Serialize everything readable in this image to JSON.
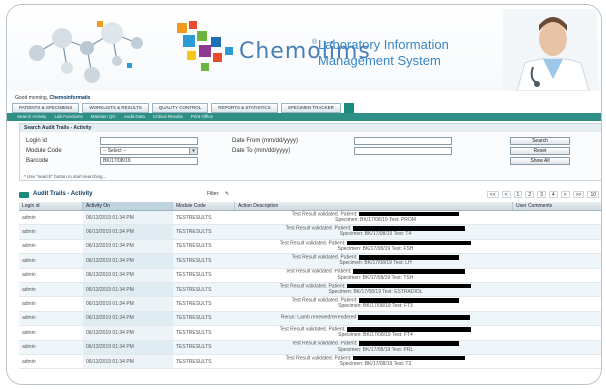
{
  "app": {
    "logo_text": "Chemolims",
    "logo_registered": "®",
    "tagline_line1": "Laboratory Information",
    "tagline_line2": "Management System"
  },
  "nav": {
    "welcome_prefix": "Good morning,",
    "welcome_user": "Chemoinformatix",
    "tabs": [
      "PATIENTS & SPECIMENS",
      "WORKLISTS & RESULTS",
      "QUALITY CONTROL",
      "REPORTS & STATISTICS",
      "SPECIMEN TRACKER"
    ],
    "sub_items": [
      "Search Activity",
      "Lab Functions",
      "Maintain QC",
      "Audit Data",
      "Critical Results",
      "Print Office"
    ]
  },
  "search": {
    "title": "Search Audit Trails - Activity",
    "login_id_label": "Login id",
    "login_id_value": "",
    "module_code_label": "Module Code",
    "module_code_value": "-- Select --",
    "barcode_label": "Barcode",
    "barcode_value": "BK/17/08/19",
    "date_from_label": "Date From (mm/dd/yyyy)",
    "date_from_value": "",
    "date_to_label": "Date To (mm/dd/yyyy)",
    "date_to_value": "",
    "search_button": "Search",
    "reset_button": "Reset",
    "show_all_button": "Show All",
    "hint": "* Use \"search\" button to start searching..."
  },
  "grid": {
    "title": "Audit Trails - Activity",
    "filter_label": "Filter:",
    "pager": [
      "<<",
      "<",
      "1",
      "2",
      "3",
      "4",
      ">",
      ">>",
      "10"
    ],
    "columns": [
      "Login id",
      "Activity On",
      "Module Code",
      "Action Description",
      "User Comments"
    ],
    "rows": [
      {
        "login": "admin",
        "on": "06/13/2019 01:34 PM",
        "module": "TESTRESULTS",
        "desc1": "Test Result validated. Patient:",
        "desc2": "Specimen: BK/17/08/19 Test: PROM"
      },
      {
        "login": "admin",
        "on": "06/13/2019 01:34 PM",
        "module": "TESTRESULTS",
        "desc1": "Test Result validated. Patient:",
        "desc2": "Specimen: BK/17/08/19 Test: T4"
      },
      {
        "login": "admin",
        "on": "06/13/2019 01:34 PM",
        "module": "TESTRESULTS",
        "desc1": "Test Result validated. Patient:",
        "desc2": "Specimen: BK/17/08/19 Test: FSH"
      },
      {
        "login": "admin",
        "on": "06/13/2019 01:34 PM",
        "module": "TESTRESULTS",
        "desc1": "Test Result validated. Patient:",
        "desc2": "Specimen: BK/17/08/19 Test: LH"
      },
      {
        "login": "admin",
        "on": "06/13/2019 01:34 PM",
        "module": "TESTRESULTS",
        "desc1": "Test Result validated. Patient:",
        "desc2": "Specimen: BK/17/08/19 Test: TSH"
      },
      {
        "login": "admin",
        "on": "06/13/2019 01:34 PM",
        "module": "TESTRESULTS",
        "desc1": "Test Result validated. Patient:",
        "desc2": "Specimen: BK/17/08/19 Test: ESTRADIOL"
      },
      {
        "login": "admin",
        "on": "06/13/2019 01:34 PM",
        "module": "TESTRESULTS",
        "desc1": "Test Result validated. Patient:",
        "desc2": "Specimen: BK/17/08/19 Test: FT3"
      },
      {
        "login": "admin",
        "on": "06/13/2019 01:34 PM",
        "module": "TESTRESULTS",
        "desc1": "Rerun: Lamb renewed/rerendered",
        "desc2": ""
      },
      {
        "login": "admin",
        "on": "06/13/2019 01:34 PM",
        "module": "TESTRESULTS",
        "desc1": "Test Result validated. Patient:",
        "desc2": "Specimen: BK/17/08/19 Test: FT4"
      },
      {
        "login": "admin",
        "on": "06/13/2019 01:34 PM",
        "module": "TESTRESULTS",
        "desc1": "Test Result validated. Patient:",
        "desc2": "Specimen: BK/17/08/19 Test: PRL"
      },
      {
        "login": "admin",
        "on": "06/13/2019 01:34 PM",
        "module": "TESTRESULTS",
        "desc1": "Test Result validated. Patient:",
        "desc2": "Specimen: BK/17/08/19 Test: T3"
      }
    ]
  },
  "colors": {
    "accent_teal": "#2d8f86",
    "header_blue": "#3a86c6",
    "row_alt": "#eef6fa"
  }
}
